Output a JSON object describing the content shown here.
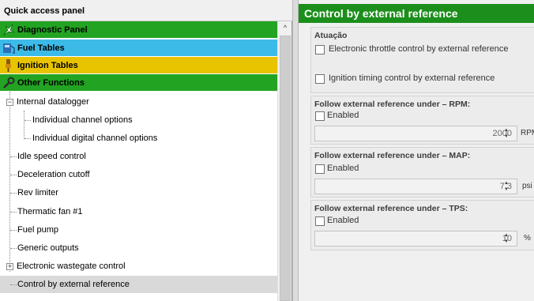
{
  "left_panel": {
    "title": "Quick access panel",
    "categories": [
      {
        "label": "Diagnostic Panel",
        "color": "#22a322",
        "icon": "diagnostic-icon"
      },
      {
        "label": "Fuel Tables",
        "color": "#3dbbe8",
        "icon": "fuel-tables-icon"
      },
      {
        "label": "Ignition Tables",
        "color": "#e8c400",
        "icon": "ignition-tables-icon"
      },
      {
        "label": "Other Functions",
        "color": "#22a322",
        "icon": "other-functions-icon"
      }
    ],
    "tree": [
      {
        "label": "Internal datalogger",
        "level": 0,
        "expander": "minus"
      },
      {
        "label": "Individual channel options",
        "level": 1
      },
      {
        "label": "Individual digital channel options",
        "level": 1
      },
      {
        "label": "Idle speed control",
        "level": 0
      },
      {
        "label": "Deceleration cutoff",
        "level": 0
      },
      {
        "label": "Rev limiter",
        "level": 0
      },
      {
        "label": "Thermatic fan #1",
        "level": 0
      },
      {
        "label": "Fuel pump",
        "level": 0
      },
      {
        "label": "Generic outputs",
        "level": 0
      },
      {
        "label": "Electronic wastegate control",
        "level": 0,
        "expander": "plus"
      },
      {
        "label": "Control by external reference",
        "level": 0,
        "selected": true
      }
    ],
    "scroll_up_glyph": "^"
  },
  "right_panel": {
    "title": "Control by external reference",
    "title_color": "#1b8e1b",
    "actuation": {
      "title": "Atuação",
      "options": [
        {
          "label": "Electronic throttle control by external reference",
          "checked": false
        },
        {
          "label": "Ignition timing control by external reference",
          "checked": false
        }
      ]
    },
    "rpm": {
      "title": "Follow external reference under – RPM:",
      "enabled_label": "Enabled",
      "value": "2000",
      "unit": "RPM"
    },
    "map": {
      "title": "Follow external reference under – MAP:",
      "enabled_label": "Enabled",
      "value": "7.3",
      "unit": "psi"
    },
    "tps": {
      "title": "Follow external reference under – TPS:",
      "enabled_label": "Enabled",
      "value": "10",
      "unit": "%"
    }
  }
}
